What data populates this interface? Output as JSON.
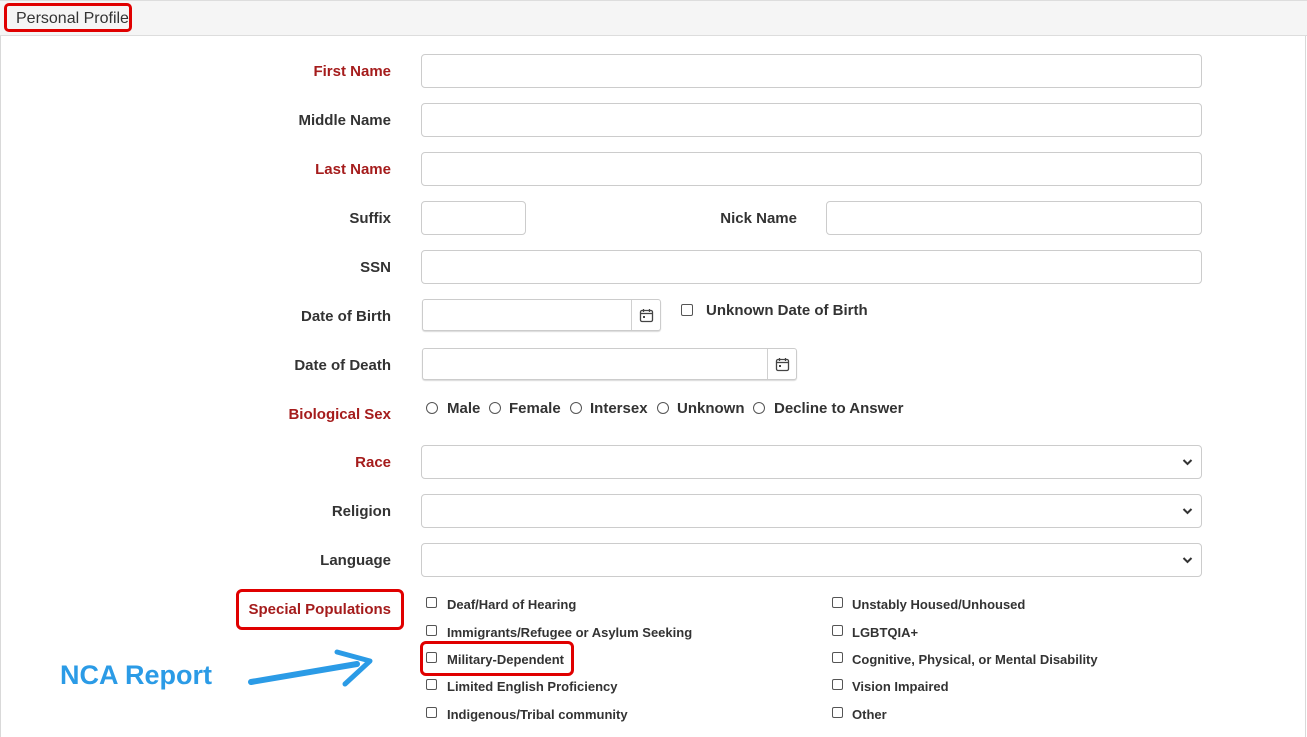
{
  "panel": {
    "title": "Personal Profile"
  },
  "fields": {
    "first_name": {
      "label": "First Name",
      "value": ""
    },
    "middle_name": {
      "label": "Middle Name",
      "value": ""
    },
    "last_name": {
      "label": "Last Name",
      "value": ""
    },
    "suffix": {
      "label": "Suffix",
      "value": ""
    },
    "nick_name": {
      "label": "Nick Name",
      "value": ""
    },
    "ssn": {
      "label": "SSN",
      "value": ""
    },
    "dob": {
      "label": "Date of Birth",
      "value": "",
      "unknown_label": "Unknown Date of Birth"
    },
    "dod": {
      "label": "Date of Death",
      "value": ""
    },
    "sex": {
      "label": "Biological Sex",
      "options": [
        "Male",
        "Female",
        "Intersex",
        "Unknown",
        "Decline to Answer"
      ]
    },
    "race": {
      "label": "Race",
      "value": ""
    },
    "religion": {
      "label": "Religion",
      "value": ""
    },
    "language": {
      "label": "Language",
      "value": ""
    },
    "special_populations": {
      "label": "Special Populations",
      "left": [
        "Deaf/Hard of Hearing",
        "Immigrants/Refugee or Asylum Seeking",
        "Military-Dependent",
        "Limited English Proficiency",
        "Indigenous/Tribal community"
      ],
      "right": [
        "Unstably Housed/Unhoused",
        "LGBTQIA+",
        "Cognitive, Physical, or Mental Disability",
        "Vision Impaired",
        "Other"
      ]
    }
  },
  "annotation": {
    "text": "NCA Report",
    "color": "#2b9be6",
    "highlight_color": "#e00000"
  },
  "required_color": "#a51c1c"
}
